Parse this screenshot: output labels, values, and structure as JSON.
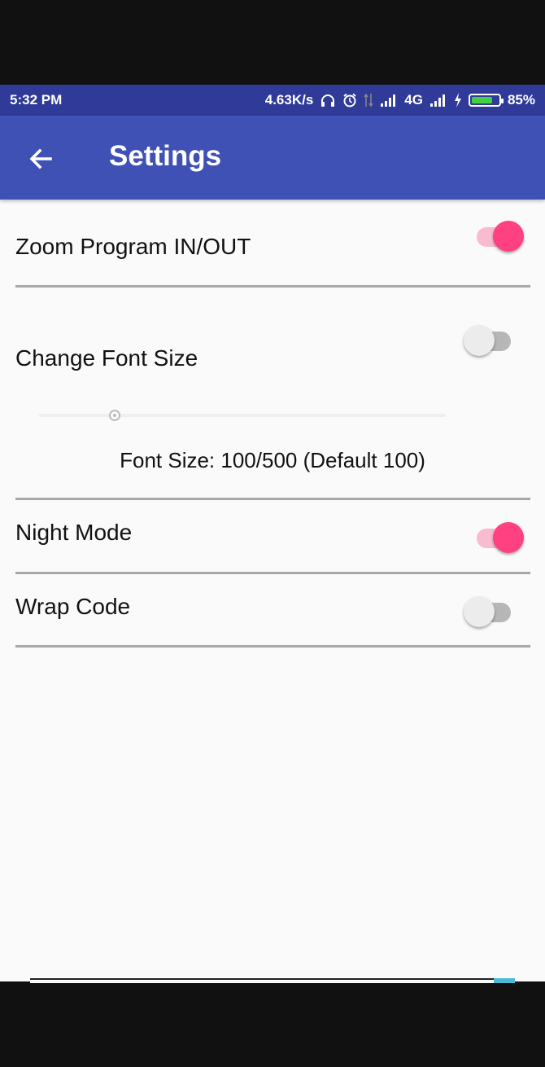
{
  "status_bar": {
    "time": "5:32 PM",
    "net_speed": "4.63K/s",
    "network_type": "4G",
    "battery": "85%",
    "battery_level": 0.85,
    "icons": [
      "headphones-icon",
      "alarm-icon",
      "data-arrows-icon",
      "signal-icon",
      "signal-icon",
      "charging-icon",
      "battery-icon"
    ]
  },
  "app_bar": {
    "title": "Settings",
    "back_icon": "arrow-back-icon",
    "color": "#3f51b5"
  },
  "settings": {
    "zoom": {
      "label": "Zoom Program IN/OUT",
      "enabled": true
    },
    "font_size": {
      "label": "Change Font Size",
      "enabled": false,
      "value": 100,
      "max": 500,
      "text": "Font Size: 100/500 (Default 100)"
    },
    "night_mode": {
      "label": "Night Mode",
      "enabled": true
    },
    "wrap_code": {
      "label": "Wrap Code",
      "enabled": false
    }
  },
  "colors": {
    "accent": "#ff4081",
    "accent_track": "#f8bbd0",
    "status_bar": "#2f3a99",
    "background": "#fafafa"
  }
}
